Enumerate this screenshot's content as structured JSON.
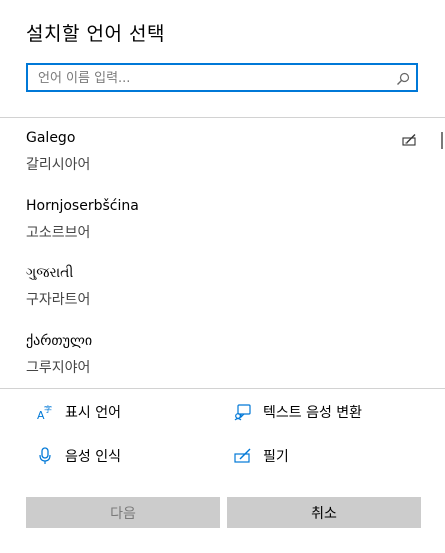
{
  "dialog": {
    "title": "설치할 언어 선택"
  },
  "search": {
    "placeholder": "언어 이름 입력..."
  },
  "languages": [
    {
      "name": "Galego",
      "native": "갈리시아어"
    },
    {
      "name": "Hornjoserbšćina",
      "native": "고소르브어"
    },
    {
      "name": "ગુજરાતી",
      "native": "구자라트어"
    },
    {
      "name": "ქართული",
      "native": "그루지야어"
    }
  ],
  "features": {
    "display_language": "표시 언어",
    "text_to_speech": "텍스트 음성 변환",
    "speech_recognition": "음성 인식",
    "handwriting": "필기"
  },
  "buttons": {
    "next": "다음",
    "cancel": "취소"
  },
  "colors": {
    "accent": "#0078d7",
    "button_bg": "#cccccc",
    "separator": "#d2d2d2"
  },
  "icons": [
    "search-icon",
    "handwriting-icon",
    "display-language-icon",
    "text-to-speech-icon",
    "microphone-icon"
  ]
}
